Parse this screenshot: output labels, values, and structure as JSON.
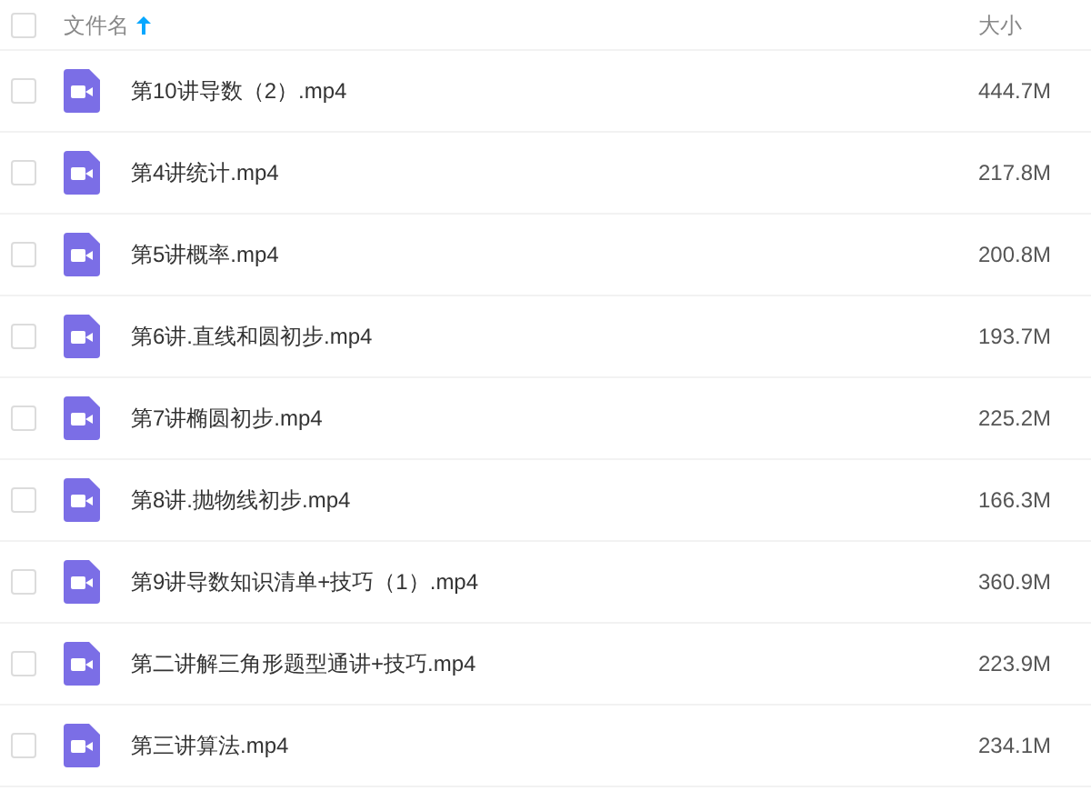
{
  "header": {
    "checked": false,
    "columns": [
      {
        "label": "文件名",
        "sorted": true
      },
      {
        "label": "大小",
        "sorted": false
      }
    ]
  },
  "files": [
    {
      "name": "第10讲导数（2）.mp4",
      "size": "444.7M",
      "checked": false
    },
    {
      "name": "第4讲统计.mp4",
      "size": "217.8M",
      "checked": false
    },
    {
      "name": "第5讲概率.mp4",
      "size": "200.8M",
      "checked": false
    },
    {
      "name": "第6讲.直线和圆初步.mp4",
      "size": "193.7M",
      "checked": false
    },
    {
      "name": "第7讲椭圆初步.mp4",
      "size": "225.2M",
      "checked": false
    },
    {
      "name": "第8讲.抛物线初步.mp4",
      "size": "166.3M",
      "checked": false
    },
    {
      "name": "第9讲导数知识清单+技巧（1）.mp4",
      "size": "360.9M",
      "checked": false
    },
    {
      "name": "第二讲解三角形题型通讲+技巧.mp4",
      "size": "223.9M",
      "checked": false
    },
    {
      "name": "第三讲算法.mp4",
      "size": "234.1M",
      "checked": false
    }
  ]
}
